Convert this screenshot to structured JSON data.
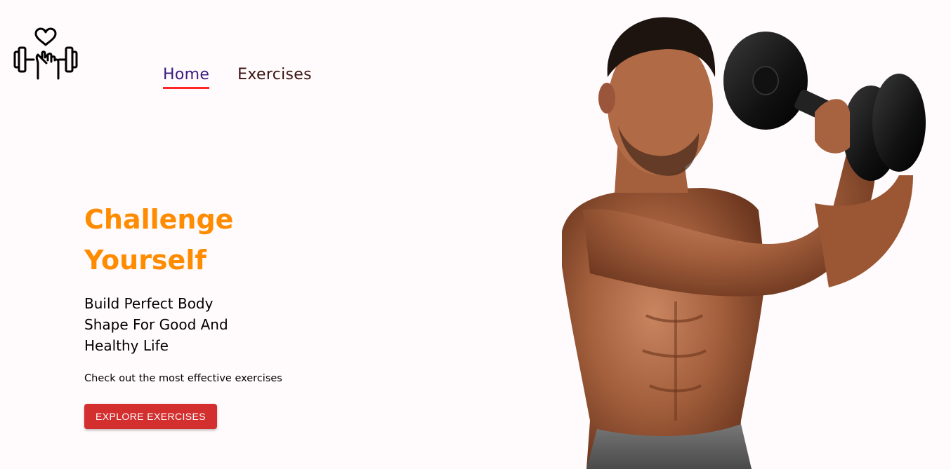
{
  "header": {
    "logo_icon": "dumbbell-heart-hand-icon",
    "nav": [
      {
        "label": "Home",
        "active": true
      },
      {
        "label": "Exercises",
        "active": false
      }
    ]
  },
  "hero": {
    "title_line1": "Challenge",
    "title_line2": "Yourself",
    "subtitle_line1": "Build Perfect Body",
    "subtitle_line2": "Shape For Good And",
    "subtitle_line3": "Healthy Life",
    "description": "Check out the most effective exercises",
    "cta_label": "EXPLORE EXERCISES",
    "banner_image": "man-lifting-dumbbell-photo"
  },
  "colors": {
    "background": "#fffafb",
    "accent_orange": "#ff8c00",
    "button_red": "#d32f2f",
    "nav_active": "#3a1d80",
    "nav_underline": "#ff2625"
  }
}
